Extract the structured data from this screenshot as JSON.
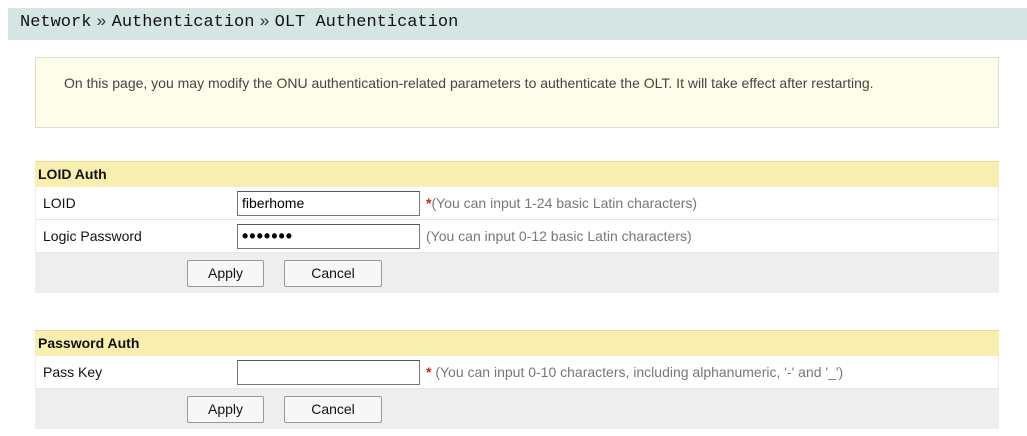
{
  "breadcrumb": {
    "items": [
      "Network",
      "Authentication",
      "OLT Authentication"
    ],
    "separator": "»"
  },
  "notice": {
    "text": "On this page, you may modify the ONU authentication-related parameters to authenticate the OLT. It will take effect after restarting."
  },
  "loid_auth": {
    "title": "LOID Auth",
    "loid_label": "LOID",
    "loid_value": "fiberhome",
    "loid_required_mark": "*",
    "loid_hint": "(You can input 1-24 basic Latin characters)",
    "password_label": "Logic Password",
    "password_value": "•••••••",
    "password_hint": "(You can input 0-12 basic Latin characters)",
    "apply_label": "Apply",
    "cancel_label": "Cancel"
  },
  "password_auth": {
    "title": "Password Auth",
    "passkey_label": "Pass Key",
    "passkey_value": "",
    "passkey_required_mark": "*",
    "passkey_hint": "(You can input 0-10 characters, including alphanumeric, '-' and '_')",
    "apply_label": "Apply",
    "cancel_label": "Cancel"
  },
  "colors": {
    "breadcrumb_bg": "#d4e5e3",
    "notice_bg": "#fefde9",
    "panel_header_bg": "#f7eeaf",
    "button_row_bg": "#eeeeee",
    "required": "#d0211b"
  }
}
